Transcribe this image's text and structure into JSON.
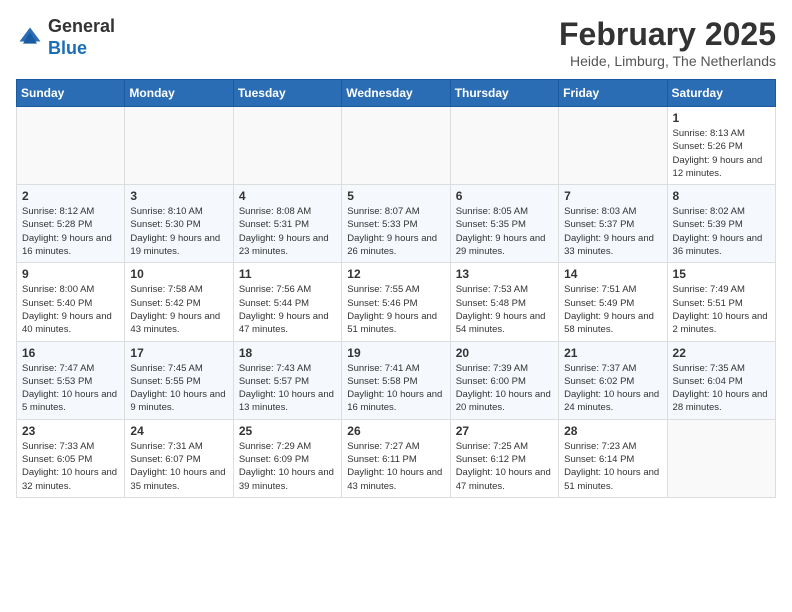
{
  "header": {
    "logo_line1": "General",
    "logo_line2": "Blue",
    "month": "February 2025",
    "location": "Heide, Limburg, The Netherlands"
  },
  "weekdays": [
    "Sunday",
    "Monday",
    "Tuesday",
    "Wednesday",
    "Thursday",
    "Friday",
    "Saturday"
  ],
  "weeks": [
    [
      {
        "day": "",
        "info": ""
      },
      {
        "day": "",
        "info": ""
      },
      {
        "day": "",
        "info": ""
      },
      {
        "day": "",
        "info": ""
      },
      {
        "day": "",
        "info": ""
      },
      {
        "day": "",
        "info": ""
      },
      {
        "day": "1",
        "info": "Sunrise: 8:13 AM\nSunset: 5:26 PM\nDaylight: 9 hours and 12 minutes."
      }
    ],
    [
      {
        "day": "2",
        "info": "Sunrise: 8:12 AM\nSunset: 5:28 PM\nDaylight: 9 hours and 16 minutes."
      },
      {
        "day": "3",
        "info": "Sunrise: 8:10 AM\nSunset: 5:30 PM\nDaylight: 9 hours and 19 minutes."
      },
      {
        "day": "4",
        "info": "Sunrise: 8:08 AM\nSunset: 5:31 PM\nDaylight: 9 hours and 23 minutes."
      },
      {
        "day": "5",
        "info": "Sunrise: 8:07 AM\nSunset: 5:33 PM\nDaylight: 9 hours and 26 minutes."
      },
      {
        "day": "6",
        "info": "Sunrise: 8:05 AM\nSunset: 5:35 PM\nDaylight: 9 hours and 29 minutes."
      },
      {
        "day": "7",
        "info": "Sunrise: 8:03 AM\nSunset: 5:37 PM\nDaylight: 9 hours and 33 minutes."
      },
      {
        "day": "8",
        "info": "Sunrise: 8:02 AM\nSunset: 5:39 PM\nDaylight: 9 hours and 36 minutes."
      }
    ],
    [
      {
        "day": "9",
        "info": "Sunrise: 8:00 AM\nSunset: 5:40 PM\nDaylight: 9 hours and 40 minutes."
      },
      {
        "day": "10",
        "info": "Sunrise: 7:58 AM\nSunset: 5:42 PM\nDaylight: 9 hours and 43 minutes."
      },
      {
        "day": "11",
        "info": "Sunrise: 7:56 AM\nSunset: 5:44 PM\nDaylight: 9 hours and 47 minutes."
      },
      {
        "day": "12",
        "info": "Sunrise: 7:55 AM\nSunset: 5:46 PM\nDaylight: 9 hours and 51 minutes."
      },
      {
        "day": "13",
        "info": "Sunrise: 7:53 AM\nSunset: 5:48 PM\nDaylight: 9 hours and 54 minutes."
      },
      {
        "day": "14",
        "info": "Sunrise: 7:51 AM\nSunset: 5:49 PM\nDaylight: 9 hours and 58 minutes."
      },
      {
        "day": "15",
        "info": "Sunrise: 7:49 AM\nSunset: 5:51 PM\nDaylight: 10 hours and 2 minutes."
      }
    ],
    [
      {
        "day": "16",
        "info": "Sunrise: 7:47 AM\nSunset: 5:53 PM\nDaylight: 10 hours and 5 minutes."
      },
      {
        "day": "17",
        "info": "Sunrise: 7:45 AM\nSunset: 5:55 PM\nDaylight: 10 hours and 9 minutes."
      },
      {
        "day": "18",
        "info": "Sunrise: 7:43 AM\nSunset: 5:57 PM\nDaylight: 10 hours and 13 minutes."
      },
      {
        "day": "19",
        "info": "Sunrise: 7:41 AM\nSunset: 5:58 PM\nDaylight: 10 hours and 16 minutes."
      },
      {
        "day": "20",
        "info": "Sunrise: 7:39 AM\nSunset: 6:00 PM\nDaylight: 10 hours and 20 minutes."
      },
      {
        "day": "21",
        "info": "Sunrise: 7:37 AM\nSunset: 6:02 PM\nDaylight: 10 hours and 24 minutes."
      },
      {
        "day": "22",
        "info": "Sunrise: 7:35 AM\nSunset: 6:04 PM\nDaylight: 10 hours and 28 minutes."
      }
    ],
    [
      {
        "day": "23",
        "info": "Sunrise: 7:33 AM\nSunset: 6:05 PM\nDaylight: 10 hours and 32 minutes."
      },
      {
        "day": "24",
        "info": "Sunrise: 7:31 AM\nSunset: 6:07 PM\nDaylight: 10 hours and 35 minutes."
      },
      {
        "day": "25",
        "info": "Sunrise: 7:29 AM\nSunset: 6:09 PM\nDaylight: 10 hours and 39 minutes."
      },
      {
        "day": "26",
        "info": "Sunrise: 7:27 AM\nSunset: 6:11 PM\nDaylight: 10 hours and 43 minutes."
      },
      {
        "day": "27",
        "info": "Sunrise: 7:25 AM\nSunset: 6:12 PM\nDaylight: 10 hours and 47 minutes."
      },
      {
        "day": "28",
        "info": "Sunrise: 7:23 AM\nSunset: 6:14 PM\nDaylight: 10 hours and 51 minutes."
      },
      {
        "day": "",
        "info": ""
      }
    ]
  ]
}
